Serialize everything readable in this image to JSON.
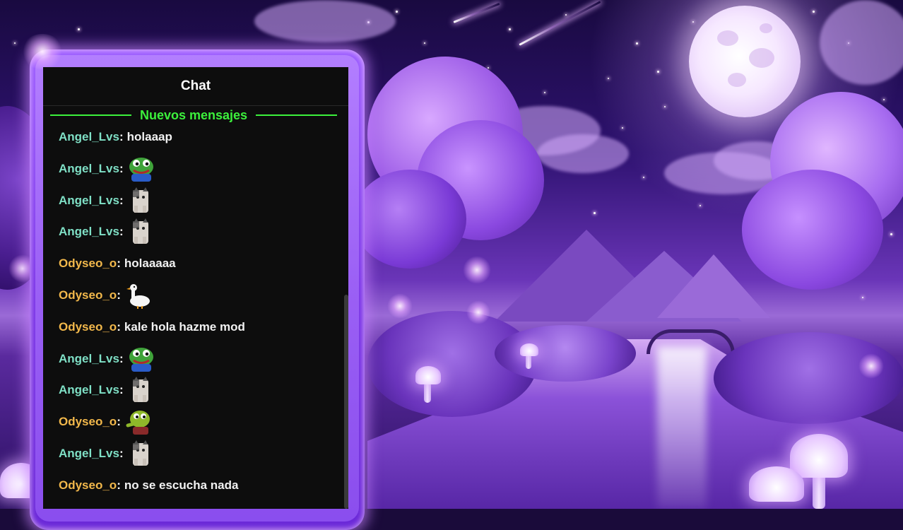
{
  "chat": {
    "title": "Chat",
    "new_messages_label": "Nuevos mensajes",
    "colors": {
      "angel": "#7fe0c6",
      "odyseo": "#f2b84b",
      "divider": "#3cf03c",
      "panel_bg": "#0d0d0d",
      "frame": "#8a46f5"
    },
    "messages": [
      {
        "user": "Angel_Lvs",
        "user_color": "angel",
        "text": "holaaap",
        "emote": null
      },
      {
        "user": "Angel_Lvs",
        "user_color": "angel",
        "text": "",
        "emote": "pepe-frog-emote"
      },
      {
        "user": "Angel_Lvs",
        "user_color": "angel",
        "text": "",
        "emote": "cat-emote"
      },
      {
        "user": "Angel_Lvs",
        "user_color": "angel",
        "text": "",
        "emote": "cat-emote"
      },
      {
        "user": "Odyseo_o",
        "user_color": "odyseo",
        "text": "holaaaaa",
        "emote": null
      },
      {
        "user": "Odyseo_o",
        "user_color": "odyseo",
        "text": "",
        "emote": "goose-emote"
      },
      {
        "user": "Odyseo_o",
        "user_color": "odyseo",
        "text": "kale hola hazme mod",
        "emote": null
      },
      {
        "user": "Angel_Lvs",
        "user_color": "angel",
        "text": "",
        "emote": "pepe-frog-emote"
      },
      {
        "user": "Angel_Lvs",
        "user_color": "angel",
        "text": "",
        "emote": "cat-emote"
      },
      {
        "user": "Odyseo_o",
        "user_color": "odyseo",
        "text": "",
        "emote": "pepe-pointing-emote"
      },
      {
        "user": "Angel_Lvs",
        "user_color": "angel",
        "text": "",
        "emote": "cat-emote"
      },
      {
        "user": "Odyseo_o",
        "user_color": "odyseo",
        "text": "no se escucha nada",
        "emote": null
      }
    ]
  }
}
